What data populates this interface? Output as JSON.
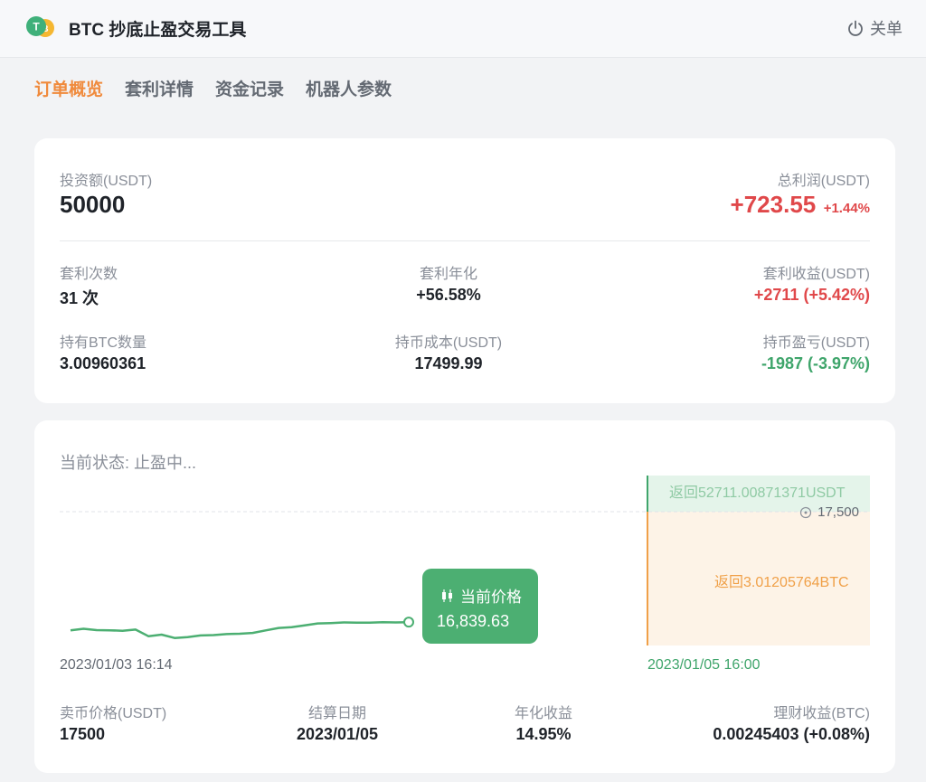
{
  "header": {
    "title": "BTC 抄底止盈交易工具",
    "close_label": "关单"
  },
  "tabs": [
    {
      "label": "订单概览",
      "active": true
    },
    {
      "label": "套利详情",
      "active": false
    },
    {
      "label": "资金记录",
      "active": false
    },
    {
      "label": "机器人参数",
      "active": false
    }
  ],
  "summary": {
    "invest_label": "投资额(USDT)",
    "invest_value": "50000",
    "profit_label": "总利润(USDT)",
    "profit_value": "+723.55",
    "profit_pct": "+1.44%",
    "arb_count_label": "套利次数",
    "arb_count_value": "31 次",
    "arb_annual_label": "套利年化",
    "arb_annual_value": "+56.58%",
    "arb_income_label": "套利收益(USDT)",
    "arb_income_value": "+2711 (+5.42%)",
    "btc_qty_label": "持有BTC数量",
    "btc_qty_value": "3.00960361",
    "cost_label": "持币成本(USDT)",
    "cost_value": "17499.99",
    "pnl_label": "持币盈亏(USDT)",
    "pnl_value": "-1987 (-3.97%)"
  },
  "status": {
    "text": "当前状态: 止盈中...",
    "tooltip_title": "当前价格",
    "current_price": "16,839.63",
    "return_usdt": "返回52711.00871371USDT",
    "return_btc": "返回3.01205764BTC",
    "target_price_label": "17,500",
    "start_date": "2023/01/03 16:14",
    "end_date": "2023/01/05 16:00",
    "sell_price_label": "卖币价格(USDT)",
    "sell_price_value": "17500",
    "settle_label": "结算日期",
    "settle_value": "2023/01/05",
    "annual_label": "年化收益",
    "annual_value": "14.95%",
    "wealth_label": "理财收益(BTC)",
    "wealth_value": "0.00245403 (+0.08%)"
  },
  "colors": {
    "accent": "#f08a3c",
    "profit_red": "#e0484a",
    "loss_green": "#3fa56b",
    "line_green": "#4caf72",
    "zone_orange": "#f0a048"
  },
  "chart_data": {
    "type": "line",
    "series": [
      {
        "values": [
          16790,
          16800,
          16792,
          16791,
          16788,
          16795,
          16755,
          16765,
          16745,
          16750,
          16760,
          16762,
          16768,
          16770,
          16775,
          16790,
          16805,
          16810,
          16820,
          16832,
          16834,
          16838,
          16836,
          16837,
          16839,
          16838,
          16839.63
        ]
      }
    ],
    "target_price": 17500
  }
}
